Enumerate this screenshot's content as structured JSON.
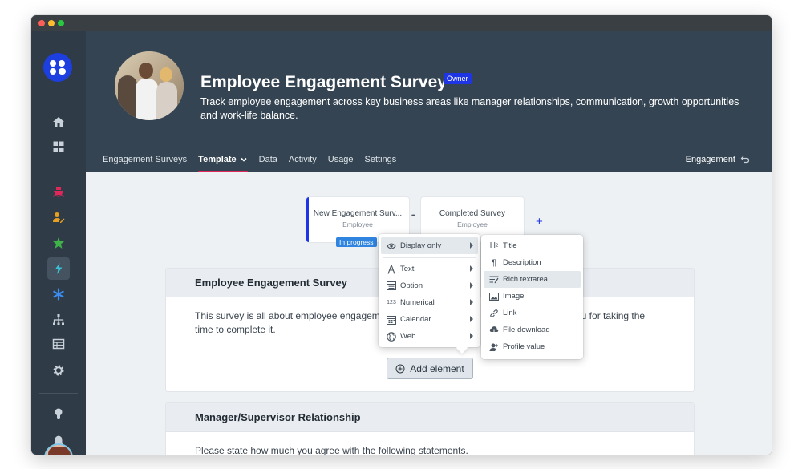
{
  "window": {
    "controls": [
      "close",
      "minimize",
      "zoom"
    ]
  },
  "sidebar": {
    "logo": "workspace-logo",
    "icons": [
      "home-icon",
      "dashboard-icon",
      "ship-icon",
      "user-edit-icon",
      "star-icon",
      "bolt-icon",
      "asterisk-icon",
      "org-chart-icon",
      "table-icon",
      "gear-icon",
      "lightbulb-icon",
      "bell-icon"
    ],
    "colors": {
      "ship": "#e0275a",
      "user": "#e8a020",
      "star": "#3fb24a",
      "bolt": "#39c2d6",
      "asterisk": "#3b8df0"
    }
  },
  "header": {
    "title": "Employee Engagement Survey",
    "badge": "Owner",
    "description": "Track employee engagement across key business areas like manager relationships, communication, growth opportunities and work-life balance.",
    "tabs": [
      "Engagement Surveys",
      "Template",
      "Data",
      "Activity",
      "Usage",
      "Settings"
    ],
    "active_tab": "Template",
    "right_link": "Engagement"
  },
  "workflow": {
    "stages": [
      {
        "name": "New Engagement Surv...",
        "role": "Employee"
      },
      {
        "name": "Completed Survey",
        "role": "Employee"
      }
    ],
    "status_badge": "In progress",
    "more": "•••",
    "add": "+"
  },
  "sections": [
    {
      "title": "Employee Engagement Survey",
      "body_left": "This survey is all about employee engagem",
      "body_right": "ou for taking the",
      "body_line2": "time to complete it."
    },
    {
      "title": "Manager/Supervisor Relationship",
      "body": "Please state how much you agree with the following statements."
    }
  ],
  "add_element": {
    "label": "Add element"
  },
  "element_menu": {
    "items": [
      {
        "label": "Display only",
        "icon": "eye-icon"
      },
      {
        "label": "Text",
        "icon": "text-a-icon"
      },
      {
        "label": "Option",
        "icon": "list-icon"
      },
      {
        "label": "Numerical",
        "icon": "123"
      },
      {
        "label": "Calendar",
        "icon": "calendar-icon"
      },
      {
        "label": "Web",
        "icon": "globe-icon"
      }
    ],
    "highlighted": "Display only"
  },
  "display_menu": {
    "items": [
      {
        "label": "Title",
        "icon": "H2"
      },
      {
        "label": "Description",
        "icon": "pilcrow-icon"
      },
      {
        "label": "Rich textarea",
        "icon": "rich-text-icon"
      },
      {
        "label": "Image",
        "icon": "image-icon"
      },
      {
        "label": "Link",
        "icon": "link-icon"
      },
      {
        "label": "File download",
        "icon": "cloud-download-icon"
      },
      {
        "label": "Profile value",
        "icon": "profile-value-icon"
      }
    ],
    "highlighted": "Rich textarea"
  }
}
